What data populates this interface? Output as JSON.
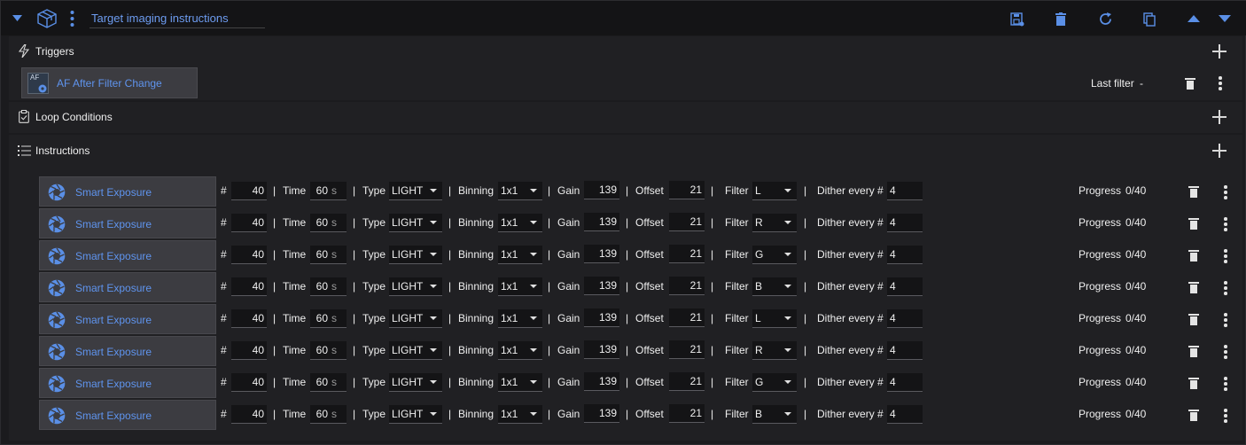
{
  "header": {
    "title": "Target imaging instructions",
    "icons": [
      "collapse-caret-icon",
      "cube-icon",
      "kebab-icon",
      "save-icon",
      "trash-icon",
      "reload-icon",
      "duplicate-icon",
      "move-up-icon",
      "move-down-icon"
    ]
  },
  "triggers": {
    "label": "Triggers",
    "item": {
      "icon_text": "AF",
      "name": "AF After Filter Change",
      "status_label": "Last filter",
      "status_value": "-"
    }
  },
  "loop_conditions": {
    "label": "Loop Conditions"
  },
  "instructions": {
    "label": "Instructions",
    "field_labels": {
      "count": "#",
      "time": "Time",
      "unit": "s",
      "type": "Type",
      "binning": "Binning",
      "gain": "Gain",
      "offset": "Offset",
      "filter": "Filter",
      "dither": "Dither every #",
      "progress": "Progress",
      "separator": "|"
    },
    "items": [
      {
        "name": "Smart Exposure",
        "count": "40",
        "time": "60",
        "type": "LIGHT",
        "binning": "1x1",
        "gain": "139",
        "offset": "21",
        "filter": "L",
        "dither": "4",
        "progress": "0/40"
      },
      {
        "name": "Smart Exposure",
        "count": "40",
        "time": "60",
        "type": "LIGHT",
        "binning": "1x1",
        "gain": "139",
        "offset": "21",
        "filter": "R",
        "dither": "4",
        "progress": "0/40"
      },
      {
        "name": "Smart Exposure",
        "count": "40",
        "time": "60",
        "type": "LIGHT",
        "binning": "1x1",
        "gain": "139",
        "offset": "21",
        "filter": "G",
        "dither": "4",
        "progress": "0/40"
      },
      {
        "name": "Smart Exposure",
        "count": "40",
        "time": "60",
        "type": "LIGHT",
        "binning": "1x1",
        "gain": "139",
        "offset": "21",
        "filter": "B",
        "dither": "4",
        "progress": "0/40"
      },
      {
        "name": "Smart Exposure",
        "count": "40",
        "time": "60",
        "type": "LIGHT",
        "binning": "1x1",
        "gain": "139",
        "offset": "21",
        "filter": "L",
        "dither": "4",
        "progress": "0/40"
      },
      {
        "name": "Smart Exposure",
        "count": "40",
        "time": "60",
        "type": "LIGHT",
        "binning": "1x1",
        "gain": "139",
        "offset": "21",
        "filter": "R",
        "dither": "4",
        "progress": "0/40"
      },
      {
        "name": "Smart Exposure",
        "count": "40",
        "time": "60",
        "type": "LIGHT",
        "binning": "1x1",
        "gain": "139",
        "offset": "21",
        "filter": "G",
        "dither": "4",
        "progress": "0/40"
      },
      {
        "name": "Smart Exposure",
        "count": "40",
        "time": "60",
        "type": "LIGHT",
        "binning": "1x1",
        "gain": "139",
        "offset": "21",
        "filter": "B",
        "dither": "4",
        "progress": "0/40"
      }
    ]
  },
  "colors": {
    "accent": "#5a8fe6",
    "background": "#1b1b1e",
    "header": "#141416",
    "item_box": "#3c3c41"
  }
}
